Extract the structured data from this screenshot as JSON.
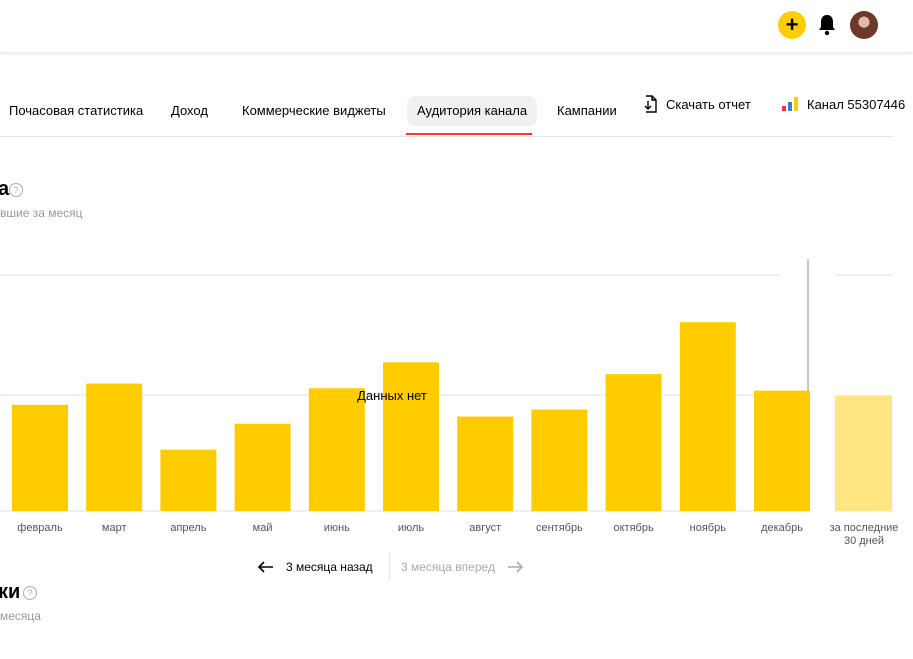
{
  "header": {
    "plus_label": "+",
    "icons": [
      "plus-icon",
      "bell-icon",
      "avatar"
    ]
  },
  "tabs": [
    {
      "label": "Почасовая статистика"
    },
    {
      "label": "Доход"
    },
    {
      "label": "Коммерческие виджеты"
    },
    {
      "label": "Аудитория канала",
      "active": true
    },
    {
      "label": "Кампании"
    }
  ],
  "actions": {
    "download_label": "Скачать отчет",
    "channel_label": "Канал 55307446"
  },
  "section1": {
    "title_fragment": "а",
    "subtitle_fragment": "вшие за месяц",
    "help_icon": "?"
  },
  "section2": {
    "title_fragment": "ки",
    "subtitle_fragment": "месяца",
    "help_icon": "?"
  },
  "colors": {
    "bar": "#ffcc00",
    "bar_light": "#ffe680",
    "accent_underline": "#ff3333",
    "muted_text": "#999999"
  },
  "chart_data": {
    "type": "bar",
    "no_data_label": "Данных нет",
    "categories": [
      "февраль",
      "март",
      "апрель",
      "май",
      "июнь",
      "июль",
      "август",
      "сентябрь",
      "октябрь",
      "ноябрь",
      "декабрь"
    ],
    "values": [
      45,
      54,
      26,
      37,
      52,
      63,
      40,
      43,
      58,
      80,
      51
    ],
    "ylim": [
      0,
      100
    ],
    "summary_category_lines": [
      "за последние",
      "30 дней"
    ],
    "summary_value": 49
  },
  "pager": {
    "back_label": "3 месяца назад",
    "forward_label": "3 месяца вперед"
  }
}
